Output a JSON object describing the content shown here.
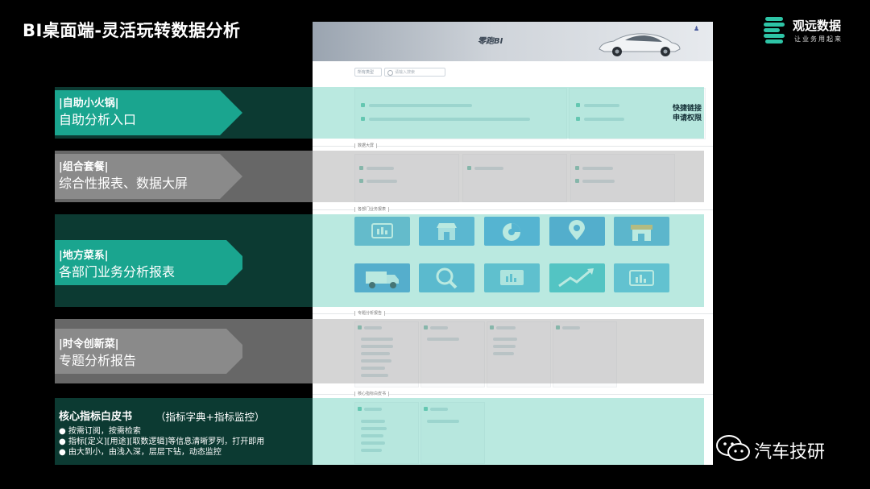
{
  "title": "BI桌面端-灵活玩转数据分析",
  "logo": {
    "name": "观远数据",
    "slogan": "让业务用起来",
    "icon": "guanyuan-logo-icon"
  },
  "screenshot": {
    "banner_title": "零跑BI",
    "user_icon": "user-icon",
    "selector_label": "所有类型",
    "search_placeholder": "请输入搜索",
    "section_headers": [
      "数据大屏",
      "各部门业务报表",
      "专题分析报告",
      "核心指标白皮书"
    ],
    "tile_icons": [
      "dashboard-icon",
      "store-icon",
      "pie-chart-icon",
      "location-pin-icon",
      "shop-icon",
      "truck-icon",
      "magnifier-icon",
      "monitor-chart-icon",
      "trend-up-icon",
      "bar-chart-icon"
    ]
  },
  "sections": [
    {
      "tag": "|自助小火锅|",
      "main": "自助分析入口",
      "color": "teal"
    },
    {
      "tag": "|组合套餐|",
      "main": "综合性报表、数据大屏",
      "color": "gray"
    },
    {
      "tag": "|地方菜系|",
      "main": "各部门业务分析报表",
      "color": "teal"
    },
    {
      "tag": "|时令创新菜|",
      "main": "专题分析报告",
      "color": "gray"
    }
  ],
  "quick_link": {
    "line1": "快捷链接",
    "line2": "申请权限"
  },
  "core": {
    "title": "核心指标白皮书",
    "subtitle": "（指标字典+指标监控）",
    "bullets": [
      "● 按需订阅，按需检索",
      "● 指标[定义][用途][取数逻辑]等信息清晰罗列，打开即用",
      "● 由大到小，由浅入深，层层下钻，动态监控"
    ]
  },
  "watermark": {
    "text": "汽车技研",
    "icon": "wechat-icon"
  }
}
